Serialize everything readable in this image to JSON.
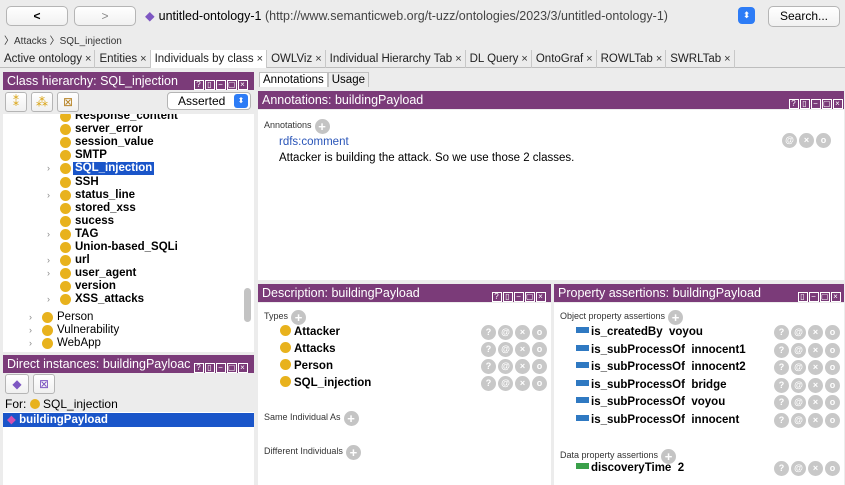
{
  "toolbar": {
    "back": "<",
    "forward": ">",
    "ontology_name": "untitled-ontology-1",
    "ontology_iri": "(http://www.semanticweb.org/t-uzz/ontologies/2023/3/untitled-ontology-1)",
    "search": "Search..."
  },
  "breadcrumb": [
    "Attacks",
    "SQL_injection"
  ],
  "tabs": [
    "Active ontology",
    "Entities",
    "Individuals by class",
    "OWLViz",
    "Individual Hierarchy Tab",
    "DL Query",
    "OntoGraf",
    "ROWLTab",
    "SWRLTab"
  ],
  "active_tab": "Individuals by class",
  "class_hierarchy": {
    "title": "Class hierarchy: SQL_injection",
    "asserted": "Asserted",
    "items": [
      {
        "label": "Response_content",
        "arrow": ""
      },
      {
        "label": "server_error",
        "arrow": ""
      },
      {
        "label": "session_value",
        "arrow": ""
      },
      {
        "label": "SMTP",
        "arrow": ""
      },
      {
        "label": "SQL_injection",
        "arrow": ">"
      },
      {
        "label": "SSH",
        "arrow": ""
      },
      {
        "label": "status_line",
        "arrow": ">"
      },
      {
        "label": "stored_xss",
        "arrow": ""
      },
      {
        "label": "sucess",
        "arrow": ""
      },
      {
        "label": "TAG",
        "arrow": ">"
      },
      {
        "label": "Union-based_SQLi",
        "arrow": ""
      },
      {
        "label": "url",
        "arrow": ">"
      },
      {
        "label": "user_agent",
        "arrow": ">"
      },
      {
        "label": "version",
        "arrow": ""
      },
      {
        "label": "XSS_attacks",
        "arrow": ">"
      }
    ],
    "top_items": [
      {
        "label": "Person",
        "arrow": ">"
      },
      {
        "label": "Vulnerability",
        "arrow": ">"
      },
      {
        "label": "WebApp",
        "arrow": ">"
      }
    ]
  },
  "direct_instances": {
    "title": "Direct instances: buildingPayloac",
    "for_label": "For:",
    "for_class": "SQL_injection",
    "items": [
      "buildingPayload"
    ]
  },
  "subtabs": [
    "Annotations",
    "Usage"
  ],
  "annotations": {
    "title": "Annotations: buildingPayload",
    "section": "Annotations",
    "property": "rdfs:comment",
    "value": "Attacker is building the attack. So we use those 2 classes."
  },
  "description": {
    "title": "Description: buildingPayload",
    "types_label": "Types",
    "types": [
      "Attacker",
      "Attacks",
      "Person",
      "SQL_injection"
    ],
    "same_label": "Same Individual As",
    "different_label": "Different Individuals"
  },
  "property_assertions": {
    "title": "Property assertions: buildingPayload",
    "object_label": "Object property assertions",
    "object": [
      {
        "prop": "is_createdBy",
        "value": "voyou"
      },
      {
        "prop": "is_subProcessOf",
        "value": "innocent1"
      },
      {
        "prop": "is_subProcessOf",
        "value": "innocent2"
      },
      {
        "prop": "is_subProcessOf",
        "value": "bridge"
      },
      {
        "prop": "is_subProcessOf",
        "value": "voyou"
      },
      {
        "prop": "is_subProcessOf",
        "value": "innocent"
      }
    ],
    "data_label": "Data property assertions",
    "data": [
      {
        "prop": "discoveryTime",
        "value": "2"
      }
    ]
  },
  "colors": {
    "panel_title": "#7b3b79",
    "selection": "#1a55c9",
    "class_dot": "#e8b21d",
    "object_prop": "#2f79c2",
    "data_prop": "#3aa04a"
  }
}
